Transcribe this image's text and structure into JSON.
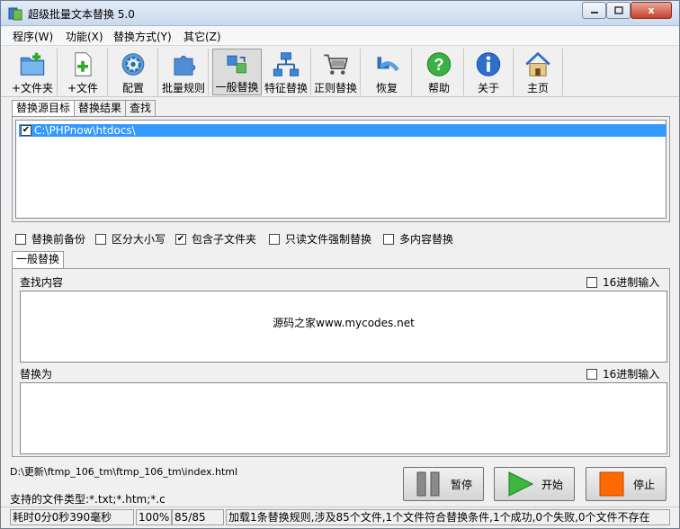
{
  "window": {
    "title": "超级批量文本替换 5.0",
    "close_glyph": "x"
  },
  "menu": [
    "程序(W)",
    "功能(X)",
    "替换方式(Y)",
    "其它(Z)"
  ],
  "toolbar": [
    {
      "label": "+文件夹",
      "icon": "folder-add-icon"
    },
    {
      "label": "+文件",
      "icon": "file-add-icon"
    },
    {
      "label": "配置",
      "icon": "config-gear-icon"
    },
    {
      "label": "批量规则",
      "icon": "puzzle-icon"
    },
    {
      "label": "一般替换",
      "icon": "general-replace-icon",
      "active": true
    },
    {
      "label": "特征替换",
      "icon": "network-icon"
    },
    {
      "label": "正则替换",
      "icon": "cart-icon"
    },
    {
      "label": "恢复",
      "icon": "restore-arrow-icon"
    },
    {
      "label": "帮助",
      "icon": "help-icon"
    },
    {
      "label": "关于",
      "icon": "info-icon"
    },
    {
      "label": "主页",
      "icon": "home-icon"
    }
  ],
  "top_tabs": [
    "替换源目标",
    "替换结果",
    "查找"
  ],
  "source_list": [
    {
      "checked": true,
      "path": "C:\\PHPnow\\htdocs\\"
    }
  ],
  "options": [
    {
      "label": "替换前备份",
      "checked": false
    },
    {
      "label": "区分大小写",
      "checked": false
    },
    {
      "label": "包含子文件夹",
      "checked": true
    },
    {
      "label": "只读文件强制替换",
      "checked": false
    },
    {
      "label": "多内容替换",
      "checked": false
    }
  ],
  "mid_tab": "一般替换",
  "find": {
    "label": "查找内容",
    "hex_label": "16进制输入",
    "hex_checked": false,
    "content": "源码之家www.mycodes.net"
  },
  "replace": {
    "label": "替换为",
    "hex_label": "16进制输入",
    "hex_checked": false,
    "content": ""
  },
  "current_file": "D:\\更新\\ftmp_106_tm\\ftmp_106_tm\\index.html",
  "file_types": "支持的文件类型:*.txt;*.htm;*.c",
  "buttons": {
    "pause": "暂停",
    "start": "开始",
    "stop": "停止"
  },
  "status": {
    "elapsed": "耗时0分0秒390毫秒",
    "progress_percent": "100%",
    "progress_count": "85/85",
    "message": "加载1条替换规则,涉及85个文件,1个文件符合替换条件,1个成功,0个失败,0个文件不存在"
  },
  "colors": {
    "selection": "#3399ff",
    "start_green": "#3cb83c",
    "stop_orange": "#ff6a00"
  }
}
